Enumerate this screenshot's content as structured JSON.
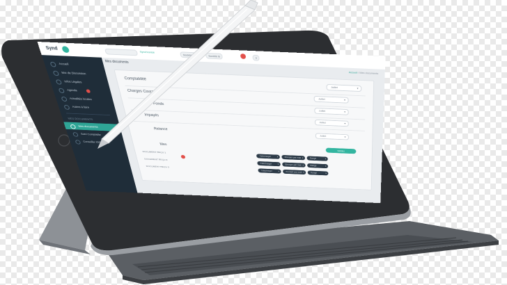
{
  "app": {
    "logo": "Synd",
    "status_ok": "Synchronisé",
    "company_a": "Société A",
    "company_b": "Société B",
    "badge_count": "3"
  },
  "nav": {
    "items": [
      {
        "label": "Accueil"
      },
      {
        "label": "Mur de Discussion"
      },
      {
        "label": "Infos Légales"
      },
      {
        "label": "Agenda"
      },
      {
        "label": "Actualités locales"
      },
      {
        "label": "Autres à faire"
      },
      {
        "label": "Mes documents"
      },
      {
        "label": "Suivi Comptable"
      },
      {
        "label": "Conseiller IDEA"
      }
    ],
    "section": "MES DOCUMENTS"
  },
  "page": {
    "title": "Mes documents",
    "breadcrumb_home": "Accueil",
    "breadcrumb_current": "Mes documents"
  },
  "rows": [
    {
      "label": "Comptabilité",
      "value": "Juillet"
    },
    {
      "label": "Charges Courantes",
      "value": "Juillet"
    },
    {
      "label": "Fonds",
      "value": "Juillet"
    },
    {
      "label": "Impayés",
      "value": "Juillet"
    },
    {
      "label": "Relance",
      "value": "Juillet"
    }
  ],
  "docs_section": {
    "title": "Mes",
    "validate_label": "Valider"
  },
  "documents": [
    {
      "name": "DOCUMENT REÇU 1",
      "actions": [
        "Télécharger",
        "Envoyer par mail",
        "Rangé"
      ]
    },
    {
      "name": "DOCUMENT REÇU 2",
      "actions": [
        "Télécharger",
        "Envoyer par mail",
        "Rangé"
      ]
    },
    {
      "name": "DOCUMENT REÇU 3",
      "actions": [
        "Télécharger",
        "Envoyer par mail",
        "Rangé"
      ]
    }
  ],
  "colors": {
    "accent": "#33b5a0",
    "sidebar": "#1f2d39",
    "danger": "#e2504a"
  }
}
